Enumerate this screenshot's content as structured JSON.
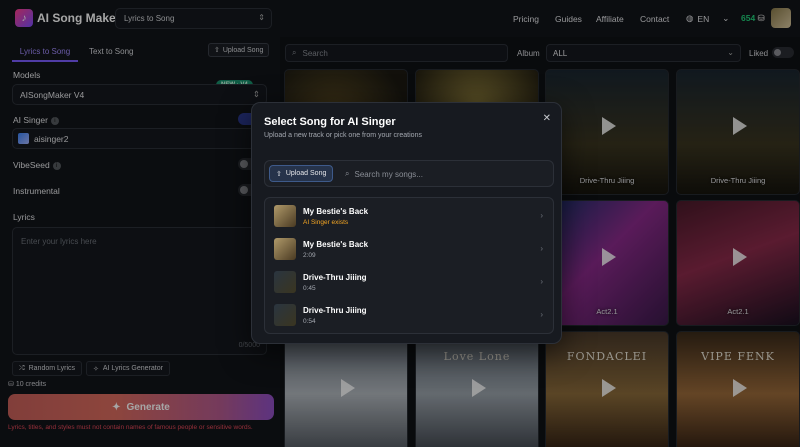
{
  "header": {
    "app_title": "AI Song Maker",
    "mode_select": "Lyrics to Song",
    "nav": [
      "Pricing",
      "Guides",
      "Affiliate",
      "Contact"
    ],
    "language": "EN",
    "credits": "654"
  },
  "left": {
    "tabs": [
      "Lyrics to Song",
      "Text to Song"
    ],
    "upload_label": "Upload Song",
    "models_label": "Models",
    "model_value": "AISongMaker V4",
    "model_badge": "NEW · V4",
    "singer_label": "AI Singer",
    "singer_value": "aisinger2",
    "vibeseed_label": "VibeSeed",
    "instrumental_label": "Instrumental",
    "lyrics_label": "Lyrics",
    "lyrics_placeholder": "Enter your lyrics here",
    "lyrics_count": "0/5000",
    "random_lyrics": "Random Lyrics",
    "ai_lyrics": "AI Lyrics Generator",
    "credits_cost": "10 credits",
    "generate_label": "Generate",
    "warning": "Lyrics, titles, and styles must not contain names of famous people or sensitive words."
  },
  "gallery": {
    "search_placeholder": "Search",
    "album_label": "Album",
    "album_value": "ALL",
    "liked_label": "Liked",
    "cards": [
      {
        "title": "",
        "art": ""
      },
      {
        "title": "",
        "art": ""
      },
      {
        "title": "Drive-Thru Jiiing",
        "art": ""
      },
      {
        "title": "Drive-Thru Jiiing",
        "art": ""
      },
      {
        "title": "",
        "art": ""
      },
      {
        "title": "",
        "art": ""
      },
      {
        "title": "Act2.1",
        "art": ""
      },
      {
        "title": "Act2.1",
        "art": ""
      },
      {
        "title": "",
        "art": ""
      },
      {
        "title": "",
        "art": "Love Lone"
      },
      {
        "title": "",
        "art": "FONDACLEI"
      },
      {
        "title": "",
        "art": "VIPE FENK"
      }
    ]
  },
  "modal": {
    "title": "Select Song for AI Singer",
    "subtitle": "Upload a new track or pick one from your creations",
    "upload_label": "Upload Song",
    "search_placeholder": "Search my songs...",
    "songs": [
      {
        "name": "My Bestie's Back",
        "meta": "AI Singer exists"
      },
      {
        "name": "My Bestie's Back",
        "meta": "2:09"
      },
      {
        "name": "Drive-Thru Jiiing",
        "meta": "0:45"
      },
      {
        "name": "Drive-Thru Jiiing",
        "meta": "0:54"
      }
    ]
  }
}
